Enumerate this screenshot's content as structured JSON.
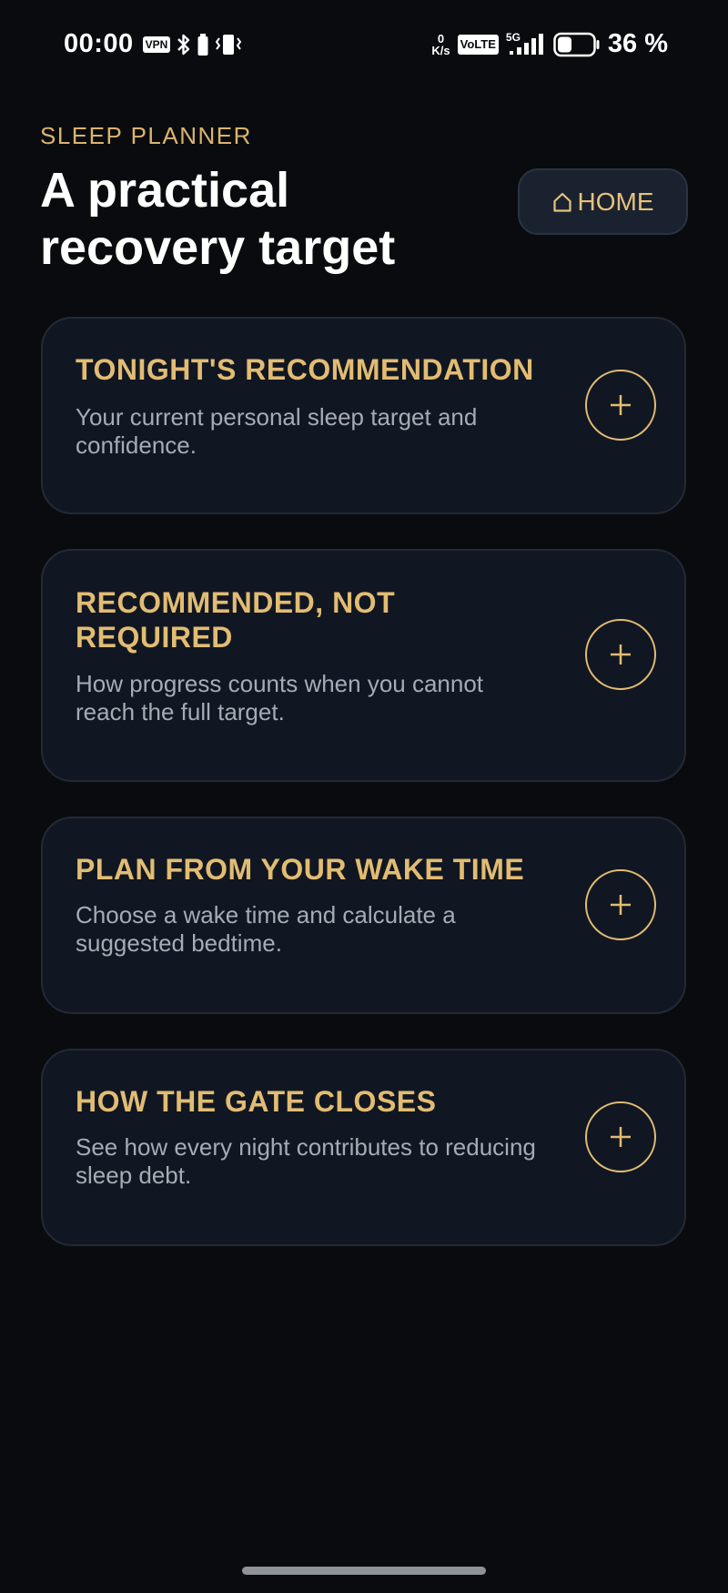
{
  "status_bar": {
    "time": "00:00",
    "vpn": "VPN",
    "net_speed_value": "0",
    "net_speed_unit": "K/s",
    "volte": "VoLTE",
    "network": "5G",
    "battery": "36 %"
  },
  "header": {
    "eyebrow": "SLEEP PLANNER",
    "title": "A practical recovery target",
    "home_label": "HOME"
  },
  "cards": [
    {
      "title": "TONIGHT'S RECOMMENDATION",
      "description": "Your current personal sleep target and confidence."
    },
    {
      "title": "RECOMMENDED, NOT REQUIRED",
      "description": "How progress counts when you cannot reach the full target."
    },
    {
      "title": "PLAN FROM YOUR WAKE TIME",
      "description": "Choose a wake time and calculate a suggested bedtime."
    },
    {
      "title": "HOW THE GATE CLOSES",
      "description": "See how every night contributes to reducing sleep debt."
    }
  ],
  "colors": {
    "background": "#0a0b0e",
    "accent": "#e2bc73",
    "card": "#111722",
    "muted_text": "#a6abb4"
  },
  "icons": [
    "home-icon",
    "plus-icon",
    "bluetooth-icon",
    "vibrate-icon",
    "battery-icon",
    "signal-icon"
  ]
}
